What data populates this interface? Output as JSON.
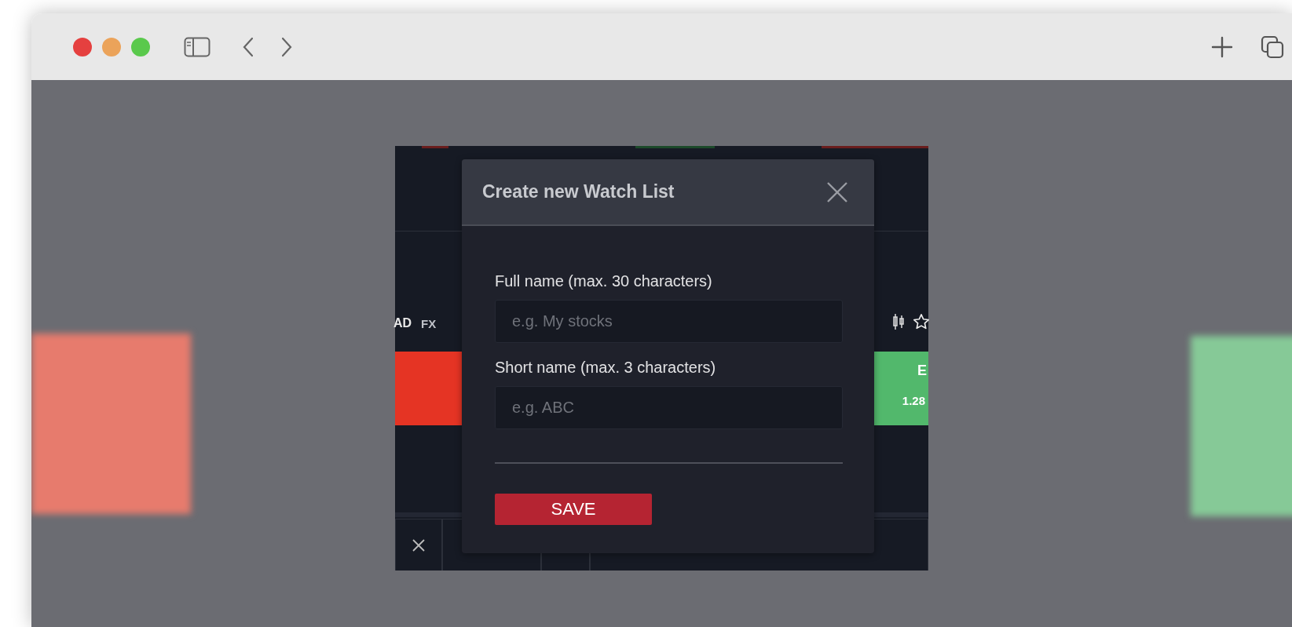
{
  "app": {
    "symbol": "AD",
    "market": "FX",
    "quote_label": "E",
    "quote_price": "1.28"
  },
  "dialog": {
    "title": "Create new Watch List",
    "fields": [
      {
        "label": "Full name (max. 30 characters)",
        "placeholder": "e.g. My stocks"
      },
      {
        "label": "Short name (max. 3 characters)",
        "placeholder": "e.g. ABC"
      }
    ],
    "save_button": "SAVE"
  }
}
